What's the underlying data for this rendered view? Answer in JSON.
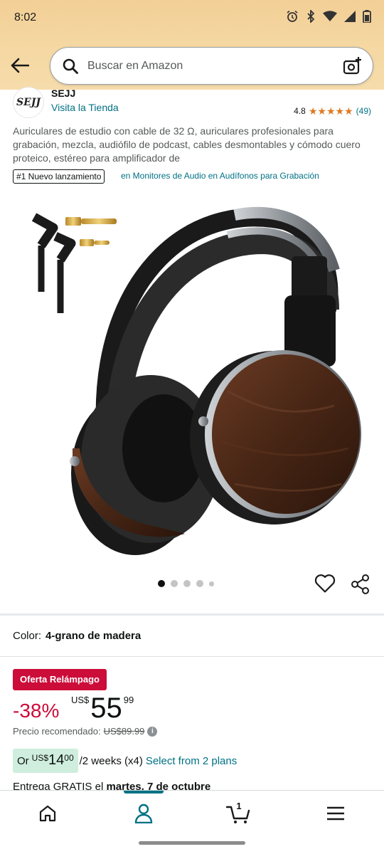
{
  "status_bar": {
    "time": "8:02",
    "icons": [
      "alarm-icon",
      "bluetooth-icon",
      "wifi-icon",
      "signal-icon",
      "battery-icon"
    ]
  },
  "header": {
    "search_placeholder": "Buscar en Amazon",
    "icons": [
      "back-arrow-icon",
      "search-icon",
      "camera-scan-icon"
    ]
  },
  "store": {
    "logo_text": "SEJJ",
    "name": "SEJJ",
    "link": "Visita la Tienda",
    "rating": "4.8",
    "stars": 5,
    "review_count": "(49)"
  },
  "product": {
    "title": "Auriculares de estudio con cable de 32 Ω, auriculares profesionales para grabación, mezcla, audiófilo de podcast, cables desmontables y cómodo cuero proteico, estéreo para amplificador de",
    "badge": "#1 Nuevo lanzamiento",
    "badge_category": "en Monitores de Audio en Audífonos para Grabación",
    "image_count": 5,
    "active_image": 1
  },
  "color": {
    "label": "Color:",
    "value": "4-grano de madera"
  },
  "pricing": {
    "deal_label": "Oferta Relámpago",
    "discount": "-38%",
    "currency": "US$",
    "whole": "55",
    "fraction": "99",
    "rrp_label": "Precio recomendado:",
    "rrp_value": "US$89.99"
  },
  "installments": {
    "or": "Or",
    "currency": "US$",
    "whole": "14",
    "fraction": "00",
    "period": "/2 weeks (x4)",
    "select": "Select from 2 plans"
  },
  "delivery": {
    "prefix": "Entrega GRATIS el",
    "date": "martes, 7 de octubre"
  },
  "bottom_nav": {
    "items": [
      "home-icon",
      "account-icon",
      "cart-icon",
      "menu-icon"
    ],
    "active": "account-icon",
    "cart_count": "1"
  },
  "colors": {
    "header_bg": "#f5d8a3",
    "link": "#007185",
    "deal_red": "#cc0c39",
    "star": "#de7921",
    "installment_bg": "#cfeedd"
  }
}
